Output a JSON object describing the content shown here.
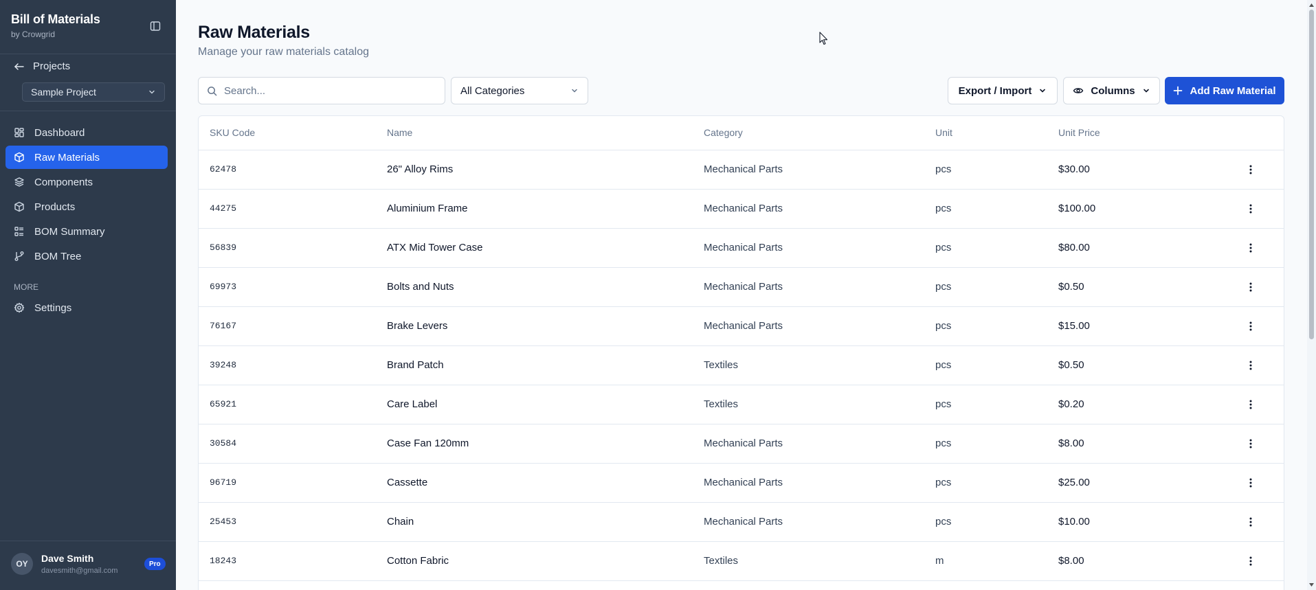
{
  "sidebar": {
    "brand_title": "Bill of Materials",
    "brand_sub": "by Crowgrid",
    "projects_label": "Projects",
    "project_selected": "Sample Project",
    "nav": [
      {
        "label": "Dashboard",
        "icon": "dashboard-icon"
      },
      {
        "label": "Raw Materials",
        "icon": "package-icon",
        "active": true
      },
      {
        "label": "Components",
        "icon": "layers-icon"
      },
      {
        "label": "Products",
        "icon": "box-icon"
      },
      {
        "label": "BOM Summary",
        "icon": "list-icon"
      },
      {
        "label": "BOM Tree",
        "icon": "git-branch-icon"
      }
    ],
    "more_label": "MORE",
    "settings_label": "Settings",
    "user": {
      "initials": "OY",
      "name": "Dave Smith",
      "email": "davesmith@gmail.com",
      "badge": "Pro"
    }
  },
  "header": {
    "title": "Raw Materials",
    "subtitle": "Manage your raw materials catalog"
  },
  "toolbar": {
    "search_placeholder": "Search...",
    "category_selected": "All Categories",
    "export_label": "Export / Import",
    "columns_label": "Columns",
    "add_label": "Add Raw Material"
  },
  "table": {
    "columns": [
      "SKU Code",
      "Name",
      "Category",
      "Unit",
      "Unit Price"
    ],
    "rows": [
      {
        "sku": "62478",
        "name": "26\" Alloy Rims",
        "category": "Mechanical Parts",
        "unit": "pcs",
        "price": "$30.00"
      },
      {
        "sku": "44275",
        "name": "Aluminium Frame",
        "category": "Mechanical Parts",
        "unit": "pcs",
        "price": "$100.00"
      },
      {
        "sku": "56839",
        "name": "ATX Mid Tower Case",
        "category": "Mechanical Parts",
        "unit": "pcs",
        "price": "$80.00"
      },
      {
        "sku": "69973",
        "name": "Bolts and Nuts",
        "category": "Mechanical Parts",
        "unit": "pcs",
        "price": "$0.50"
      },
      {
        "sku": "76167",
        "name": "Brake Levers",
        "category": "Mechanical Parts",
        "unit": "pcs",
        "price": "$15.00"
      },
      {
        "sku": "39248",
        "name": "Brand Patch",
        "category": "Textiles",
        "unit": "pcs",
        "price": "$0.50"
      },
      {
        "sku": "65921",
        "name": "Care Label",
        "category": "Textiles",
        "unit": "pcs",
        "price": "$0.20"
      },
      {
        "sku": "30584",
        "name": "Case Fan 120mm",
        "category": "Mechanical Parts",
        "unit": "pcs",
        "price": "$8.00"
      },
      {
        "sku": "96719",
        "name": "Cassette",
        "category": "Mechanical Parts",
        "unit": "pcs",
        "price": "$25.00"
      },
      {
        "sku": "25453",
        "name": "Chain",
        "category": "Mechanical Parts",
        "unit": "pcs",
        "price": "$10.00"
      },
      {
        "sku": "18243",
        "name": "Cotton Fabric",
        "category": "Textiles",
        "unit": "m",
        "price": "$8.00"
      }
    ]
  },
  "colors": {
    "sidebar_bg": "#2d3a4b",
    "accent": "#2563eb",
    "primary_button": "#1e52d6"
  }
}
